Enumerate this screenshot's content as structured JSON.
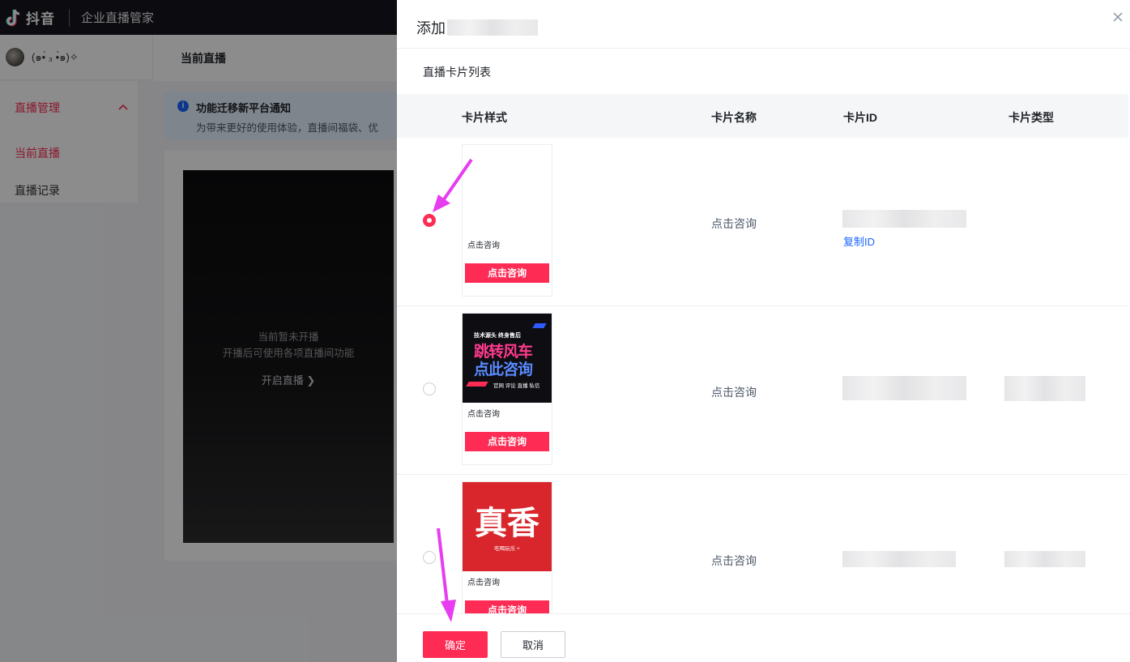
{
  "topbar": {
    "brand": "抖音",
    "product": "企业直播管家"
  },
  "user": {
    "name": "(๑•́ ₃ •̀๑)✧"
  },
  "sidebar": {
    "group_label": "直播管理",
    "items": [
      {
        "label": "当前直播",
        "active": true
      },
      {
        "label": "直播记录",
        "active": false
      }
    ]
  },
  "main": {
    "title": "当前直播",
    "notice": {
      "title": "功能迁移新平台通知",
      "text": "为带来更好的使用体验，直播间福袋、优"
    },
    "live": {
      "line1": "当前暂未开播",
      "line2": "开播后可使用各项直播间功能",
      "start": "开启直播 ❯"
    }
  },
  "drawer": {
    "title": "添加",
    "section": "直播卡片列表",
    "columns": [
      "卡片样式",
      "卡片名称",
      "卡片ID",
      "卡片类型"
    ],
    "rows": [
      {
        "selected": true,
        "caption": "点击咨询",
        "button": "点击咨询",
        "name": "点击咨询",
        "copy": "复制ID",
        "image": "blank"
      },
      {
        "selected": false,
        "caption": "点击咨询",
        "button": "点击咨询",
        "name": "点击咨询",
        "copy": "",
        "image": "dark-poster",
        "poster": {
          "top": "技术源头 终身售后",
          "l1": "跳转风车",
          "l2": "点此咨询",
          "bottom": "官网 评论 直播 私信"
        }
      },
      {
        "selected": false,
        "caption": "点击咨询",
        "button": "点击咨询",
        "name": "点击咨询",
        "copy": "",
        "image": "red-poster",
        "poster": {
          "main": "真香",
          "sub": "吃喝玩乐 +"
        }
      }
    ],
    "ok_label": "确定",
    "cancel_label": "取消"
  },
  "colors": {
    "accent": "#fe2c55",
    "link": "#1664ff",
    "annotation": "#e83cf0"
  },
  "icons": [
    "douyin-logo-icon",
    "chevron-up-icon",
    "info-icon",
    "close-icon",
    "chevron-right-icon"
  ]
}
